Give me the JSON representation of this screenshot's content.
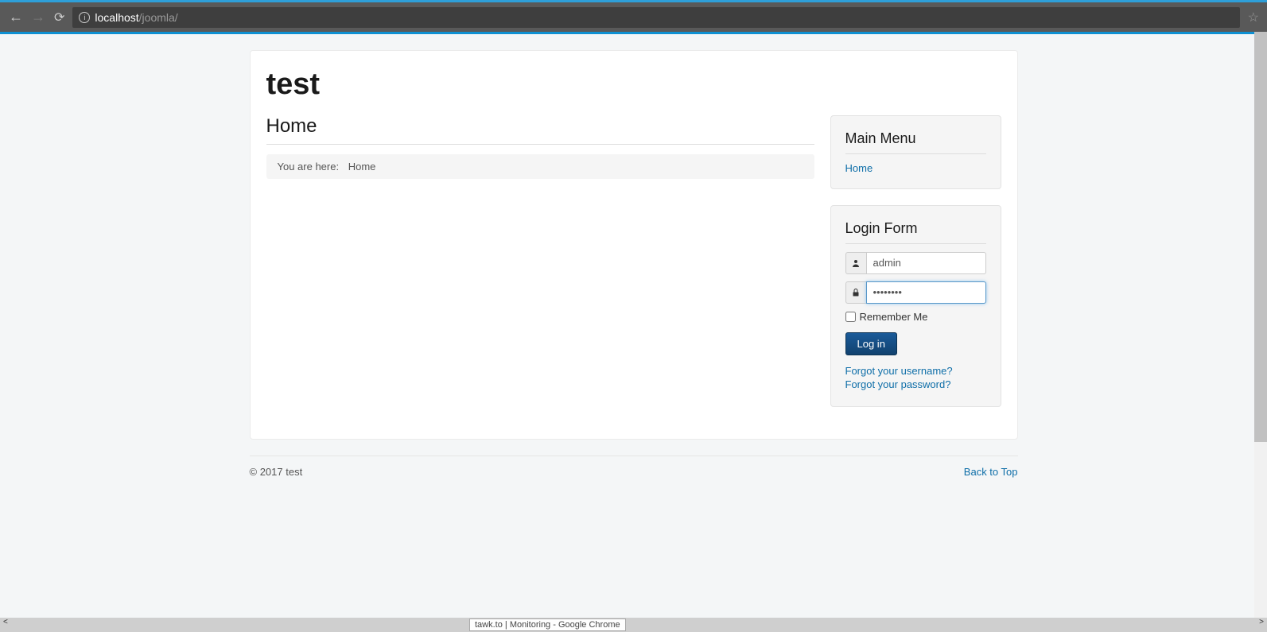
{
  "browser": {
    "url_host": "localhost",
    "url_path": "/joomla/"
  },
  "site": {
    "title": "test"
  },
  "page": {
    "heading": "Home",
    "breadcrumb_label": "You are here:",
    "breadcrumb_current": "Home"
  },
  "sidebar": {
    "main_menu": {
      "title": "Main Menu",
      "home": "Home"
    },
    "login": {
      "title": "Login Form",
      "username_value": "admin",
      "password_value": "••••••••",
      "remember_label": "Remember Me",
      "login_button": "Log in",
      "forgot_username": "Forgot your username?",
      "forgot_password": "Forgot your password?"
    }
  },
  "footer": {
    "copyright": "© 2017 test",
    "back_to_top": "Back to Top"
  },
  "status": {
    "tooltip": "tawk.to | Monitoring - Google Chrome"
  }
}
